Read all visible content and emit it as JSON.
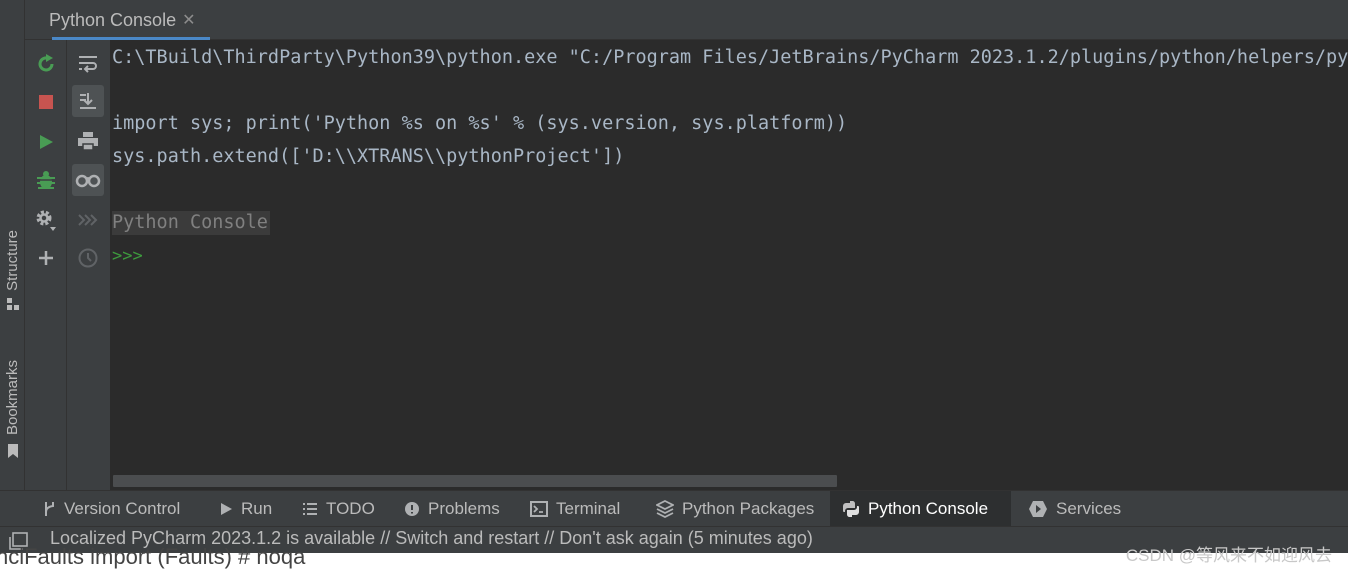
{
  "window": {
    "tab_title": "Python Console",
    "tab_close_glyph": "✕"
  },
  "left_stripe": {
    "structure_label": "Structure",
    "bookmarks_label": "Bookmarks"
  },
  "toolbar_left": {
    "icons": [
      "rerun-icon",
      "stop-icon",
      "execute-icon",
      "debug-icon",
      "settings-icon",
      "add-icon"
    ]
  },
  "toolbar_right": {
    "icons": [
      "soft-wrap-icon",
      "scroll-to-end-icon",
      "print-icon",
      "show-variables-icon",
      "execute-history-icon",
      "history-icon"
    ],
    "toggled": [
      "scroll-to-end-icon",
      "show-variables-icon"
    ]
  },
  "console": {
    "command_line": "C:\\TBuild\\ThirdParty\\Python39\\python.exe \"C:/Program Files/JetBrains/PyCharm 2023.1.2/plugins/python/helpers/pydev/pydevconsole.py\"",
    "import_line": "import sys; print('Python %s on %s' % (sys.version, sys.platform))",
    "path_line": "sys.path.extend(['D:\\\\XTRANS\\\\pythonProject'])",
    "banner": "Python Console",
    "prompt": ">>>"
  },
  "bottom_tabs": [
    {
      "label": "Version Control",
      "icon": "branch-icon"
    },
    {
      "label": "Run",
      "icon": "run-icon"
    },
    {
      "label": "TODO",
      "icon": "list-icon"
    },
    {
      "label": "Problems",
      "icon": "problems-icon"
    },
    {
      "label": "Terminal",
      "icon": "terminal-icon"
    },
    {
      "label": "Python Packages",
      "icon": "packages-icon"
    },
    {
      "label": "Python Console",
      "icon": "python-icon",
      "active": true
    },
    {
      "label": "Services",
      "icon": "services-icon"
    }
  ],
  "status": {
    "message": "Localized PyCharm 2023.1.2 is available // Switch and restart // Don't ask again (5 minutes ago)"
  },
  "below": {
    "text": "nciFaults import (Faults) # noqa",
    "watermark": "CSDN @等风来不如迎风去"
  },
  "colors": {
    "console_bg": "#2b2b2b",
    "panel_bg": "#3c3f41",
    "code_text": "#a9b7c6",
    "prompt": "#3d9b3d",
    "accent": "#4a88c7",
    "green_icon": "#499c54",
    "red_icon": "#c75450"
  }
}
